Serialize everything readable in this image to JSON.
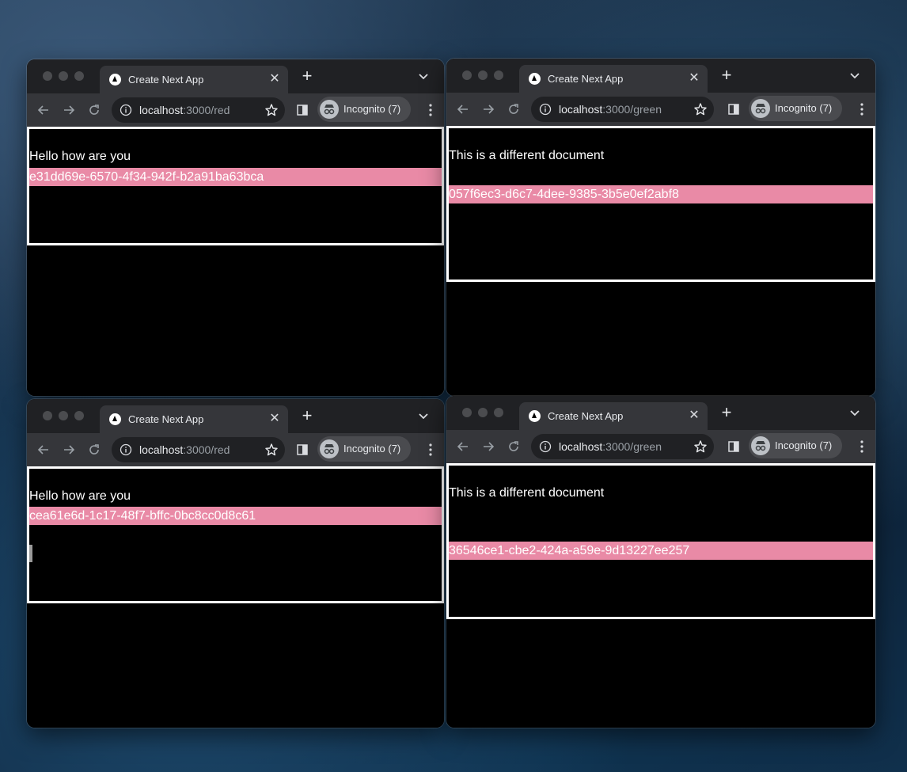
{
  "windows": [
    {
      "tab_title": "Create Next App",
      "url_host": "localhost",
      "url_path": ":3000/red",
      "profile_label": "Incognito (7)",
      "heading": "Hello how are you",
      "uuid": "e31dd69e-6570-4f34-942f-b2a91ba63bca"
    },
    {
      "tab_title": "Create Next App",
      "url_host": "localhost",
      "url_path": ":3000/green",
      "profile_label": "Incognito (7)",
      "heading": "This is a different document",
      "uuid": "057f6ec3-d6c7-4dee-9385-3b5e0ef2abf8"
    },
    {
      "tab_title": "Create Next App",
      "url_host": "localhost",
      "url_path": ":3000/red",
      "profile_label": "Incognito (7)",
      "heading": "Hello how are you",
      "uuid": "cea61e6d-1c17-48f7-bffc-0bc8cc0d8c61"
    },
    {
      "tab_title": "Create Next App",
      "url_host": "localhost",
      "url_path": ":3000/green",
      "profile_label": "Incognito (7)",
      "heading": "This is a different document",
      "uuid": "36546ce1-cbe2-424a-a59e-9d13227ee257"
    }
  ],
  "icons": {
    "favicon": "nextjs-triangle-icon",
    "close": "close-icon",
    "new_tab": "plus-icon",
    "tab_search": "chevron-down-icon",
    "back": "arrow-left-icon",
    "forward": "arrow-right-icon",
    "reload": "reload-icon",
    "site_info": "info-icon",
    "bookmark": "star-icon",
    "side_panel": "side-panel-icon",
    "incognito": "incognito-icon",
    "menu": "kebab-menu-icon"
  },
  "colors": {
    "uuid_highlight": "#e98aa6",
    "page_border": "#ffffff",
    "page_background": "#000000"
  }
}
